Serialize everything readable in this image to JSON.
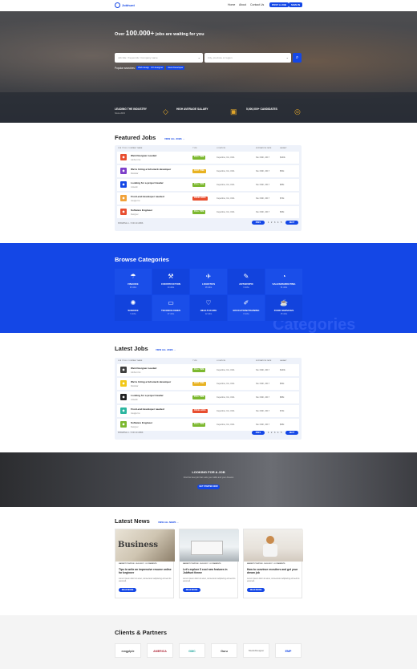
{
  "nav": {
    "logo": "Jobhunt",
    "links": [
      "Home",
      "About",
      "Contact Us"
    ],
    "post_job": "POST A JOB",
    "sign_in": "SIGN IN"
  },
  "hero": {
    "title_pre": "Over",
    "title_num": "100.000",
    "title_post": "jobs are waiting for you",
    "keyword_placeholder": "Job title / Keywords / Company name",
    "location_placeholder": "City, province or region",
    "popular_label": "Popular searches:",
    "tags": [
      "Web design",
      "UX designer",
      "Java Developer"
    ],
    "stats": [
      {
        "title": "LEADING THE INDUSTRY",
        "sub": "Since 2015"
      },
      {
        "title": "HIGH AVERAGE SALARY",
        "sub": ""
      },
      {
        "title": "5,000,000+ CANDIDATES",
        "sub": ""
      }
    ]
  },
  "featured": {
    "title": "Featured Jobs",
    "view_all": "VIEW ALL JOBS  →",
    "headers": [
      "JOB TITLE / COMPANY NAME",
      "TYPE",
      "LOCATION",
      "EXPIRATION DATE",
      "SALARY"
    ],
    "jobs": [
      {
        "title": "Web Designer needed",
        "company": "Jobhunt Inc.",
        "type": "FULL TIME",
        "location": "Cupertino, CA, USA",
        "date": "Nov 30th, 2017",
        "salary": "$100k",
        "logo_color": "#e84e30",
        "type_color": "#7cb82f"
      },
      {
        "title": "We're hiring a full-stack developer",
        "company": "Rockstar",
        "type": "PART TIME",
        "location": "Cupertino, CA, USA",
        "date": "Nov 30th, 2017",
        "salary": "$50k",
        "logo_color": "#7d3fc9",
        "type_color": "#e8b221"
      },
      {
        "title": "Looking for a project leader",
        "company": "Linkedin",
        "type": "FULL TIME",
        "location": "Cupertino, CA, USA",
        "date": "Nov 30th, 2017",
        "salary": "$85k",
        "logo_color": "#1447e6",
        "type_color": "#7cb82f"
      },
      {
        "title": "Front-end developer needed",
        "company": "Google Inc.",
        "type": "FREELANCE",
        "location": "Cupertino, CA, USA",
        "date": "Nov 30th, 2017",
        "salary": "$70k",
        "logo_color": "#f1a23a",
        "type_color": "#e84e30"
      },
      {
        "title": "Software Engineer",
        "company": "Designer",
        "type": "FULL TIME",
        "location": "Cupertino, CA, USA",
        "date": "Nov 30th, 2017",
        "salary": "$95k",
        "logo_color": "#e84e30",
        "type_color": "#7cb82f"
      }
    ],
    "showing": "SHOWING 1 - 5 OF 20 JOBS",
    "prev": "PREV",
    "next": "NEXT",
    "pages": [
      "1",
      "2",
      "3",
      "4",
      "5"
    ]
  },
  "categories": {
    "title": "Browse Categories",
    "watermark": "Categories",
    "items": [
      {
        "name": "FINANCE",
        "count": "23 Jobs",
        "icon": "☂"
      },
      {
        "name": "CONSTRUCTION",
        "count": "14 Jobs",
        "icon": "⚒"
      },
      {
        "name": "LOGISTICS",
        "count": "18 Jobs",
        "icon": "✈"
      },
      {
        "name": "ANTHROPIC",
        "count": "6 Jobs",
        "icon": "✎"
      },
      {
        "name": "SALES/MARKETING",
        "count": "31 Jobs",
        "icon": "◔"
      },
      {
        "name": "SCIENCE",
        "count": "9 Jobs",
        "icon": "✺"
      },
      {
        "name": "TECHNOLOGIES",
        "count": "27 Jobs",
        "icon": "▭"
      },
      {
        "name": "HEALTHCARE",
        "count": "12 Jobs",
        "icon": "♡"
      },
      {
        "name": "EDUCATION/TRAINING",
        "count": "8 Jobs",
        "icon": "✐"
      },
      {
        "name": "FOOD SERVICES",
        "count": "15 Jobs",
        "icon": "☕"
      }
    ]
  },
  "latest": {
    "title": "Latest Jobs",
    "view_all": "VIEW ALL JOBS  →",
    "headers": [
      "JOB TITLE / COMPANY NAME",
      "TYPE",
      "LOCATION",
      "EXPIRATION DATE",
      "SALARY"
    ],
    "jobs": [
      {
        "title": "Web Designer needed",
        "company": "Jobhunt Inc.",
        "type": "FULL TIME",
        "location": "Cupertino, CA, USA",
        "date": "Nov 30th, 2017",
        "salary": "$100k",
        "logo_color": "#3f3f3f",
        "type_color": "#7cb82f"
      },
      {
        "title": "We're hiring a full-stack developer",
        "company": "Rockstar",
        "type": "PART TIME",
        "location": "Cupertino, CA, USA",
        "date": "Nov 30th, 2017",
        "salary": "$50k",
        "logo_color": "#f2c818",
        "type_color": "#e8b221"
      },
      {
        "title": "Looking for a project leader",
        "company": "Linkedin",
        "type": "FULL TIME",
        "location": "Cupertino, CA, USA",
        "date": "Nov 30th, 2017",
        "salary": "$85k",
        "logo_color": "#222222",
        "type_color": "#7cb82f"
      },
      {
        "title": "Front-end developer needed",
        "company": "Google Inc.",
        "type": "FREELANCE",
        "location": "Cupertino, CA, USA",
        "date": "Nov 30th, 2017",
        "salary": "$70k",
        "logo_color": "#2bb5a0",
        "type_color": "#e84e30"
      },
      {
        "title": "Software Engineer",
        "company": "Designer",
        "type": "FULL TIME",
        "location": "Cupertino, CA, USA",
        "date": "Nov 30th, 2017",
        "salary": "$95k",
        "logo_color": "#7cb82f",
        "type_color": "#7cb82f"
      }
    ],
    "showing": "SHOWING 1 - 5 OF 20 JOBS",
    "prev": "PREV",
    "next": "NEXT",
    "pages": [
      "1",
      "2",
      "3",
      "4",
      "5"
    ]
  },
  "lookjob": {
    "title": "LOOKING FOR A JOB",
    "subtitle": "Find the best job that suits your skills and your dreams",
    "button": "GET STARTED NOW"
  },
  "news": {
    "title": "Latest News",
    "view_all": "VIEW ALL NEWS  →",
    "posts": [
      {
        "meta": "MARKET POSITION · 09.03.2017 · 8 COMMENTS",
        "title": "Tips to write an impressive resume online for beginner",
        "excerpt": "Lorem ipsum dolor sit amet, consectetur adipiscing elit sed do eiusmod.",
        "button": "READ MORE",
        "img_label": "Business"
      },
      {
        "meta": "MARKET POSITION · 09.03.2017 · 8 COMMENTS",
        "title": "Let's explore 5 cool new features in JobHunt theme",
        "excerpt": "Lorem ipsum dolor sit amet, consectetur adipiscing elit sed do eiusmod.",
        "button": "READ MORE",
        "img_label": ""
      },
      {
        "meta": "MARKET POSITION · 09.03.2017 · 8 COMMENTS",
        "title": "How to convince recruiters and get your dream job",
        "excerpt": "Lorem ipsum dolor sit amet, consectetur adipiscing elit sed do eiusmod.",
        "button": "READ MORE",
        "img_label": ""
      }
    ]
  },
  "clients": {
    "title": "Clients & Partners",
    "logos": [
      "mngplple",
      "AMERICA",
      "GMC",
      "Guru",
      "StudioDesigner",
      "EMP"
    ]
  }
}
